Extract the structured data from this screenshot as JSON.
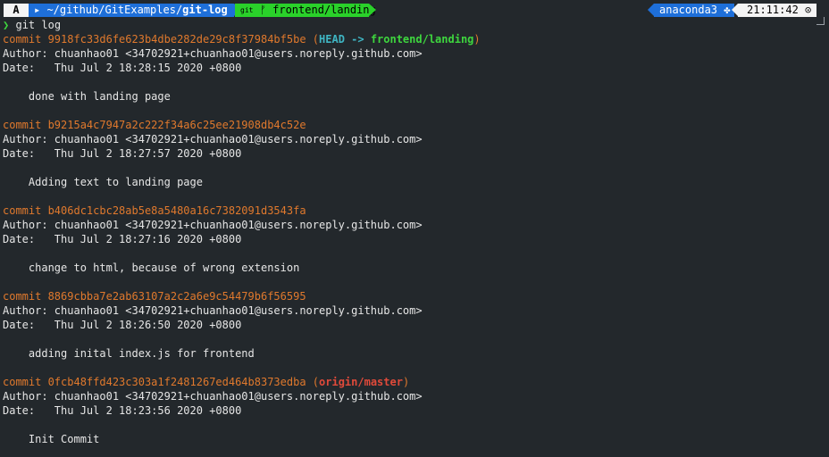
{
  "prompt": {
    "os_icon": "A",
    "dir_icon": "folder-icon",
    "dir_prefix": "~/github/GitExamples/",
    "dir_current": "git-log",
    "git_label": "git",
    "branch_icon": "branch-icon",
    "branch": "frontend/landing",
    "env_name": "anaconda3",
    "env_icon": "python-icon",
    "time": "21:11:42",
    "clock_icon": "clock-icon"
  },
  "command": {
    "prompt_char": "❯",
    "text": "git log"
  },
  "commits": [
    {
      "hash_line": "commit 9918fc33d6fe623b4dbe282de29c8f37984bf5be",
      "refs_open": " (",
      "head": "HEAD -> ",
      "ref": "frontend/landing",
      "ref_kind": "branch",
      "refs_close": ")",
      "author": "Author: chuanhao01 <34702921+chuanhao01@users.noreply.github.com>",
      "date": "Date:   Thu Jul 2 18:28:15 2020 +0800",
      "message": "    done with landing page"
    },
    {
      "hash_line": "commit b9215a4c7947a2c222f34a6c25ee21908db4c52e",
      "author": "Author: chuanhao01 <34702921+chuanhao01@users.noreply.github.com>",
      "date": "Date:   Thu Jul 2 18:27:57 2020 +0800",
      "message": "    Adding text to landing page"
    },
    {
      "hash_line": "commit b406dc1cbc28ab5e8a5480a16c7382091d3543fa",
      "author": "Author: chuanhao01 <34702921+chuanhao01@users.noreply.github.com>",
      "date": "Date:   Thu Jul 2 18:27:16 2020 +0800",
      "message": "    change to html, because of wrong extension"
    },
    {
      "hash_line": "commit 8869cbba7e2ab63107a2c2a6e9c54479b6f56595",
      "author": "Author: chuanhao01 <34702921+chuanhao01@users.noreply.github.com>",
      "date": "Date:   Thu Jul 2 18:26:50 2020 +0800",
      "message": "    adding inital index.js for frontend"
    },
    {
      "hash_line": "commit 0fcb48ffd423c303a1f2481267ed464b8373edba",
      "refs_open": " (",
      "ref": "origin/master",
      "ref_kind": "origin",
      "refs_close": ")",
      "author": "Author: chuanhao01 <34702921+chuanhao01@users.noreply.github.com>",
      "date": "Date:   Thu Jul 2 18:23:56 2020 +0800",
      "message": "    Init Commit"
    }
  ],
  "colors": {
    "background": "#23282c",
    "commit": "#e0792d",
    "head": "#3fb6c4",
    "branch": "#3ed63e",
    "origin": "#e04a3a",
    "dir_segment": "#1e6fd9",
    "git_segment": "#2ad12a"
  }
}
